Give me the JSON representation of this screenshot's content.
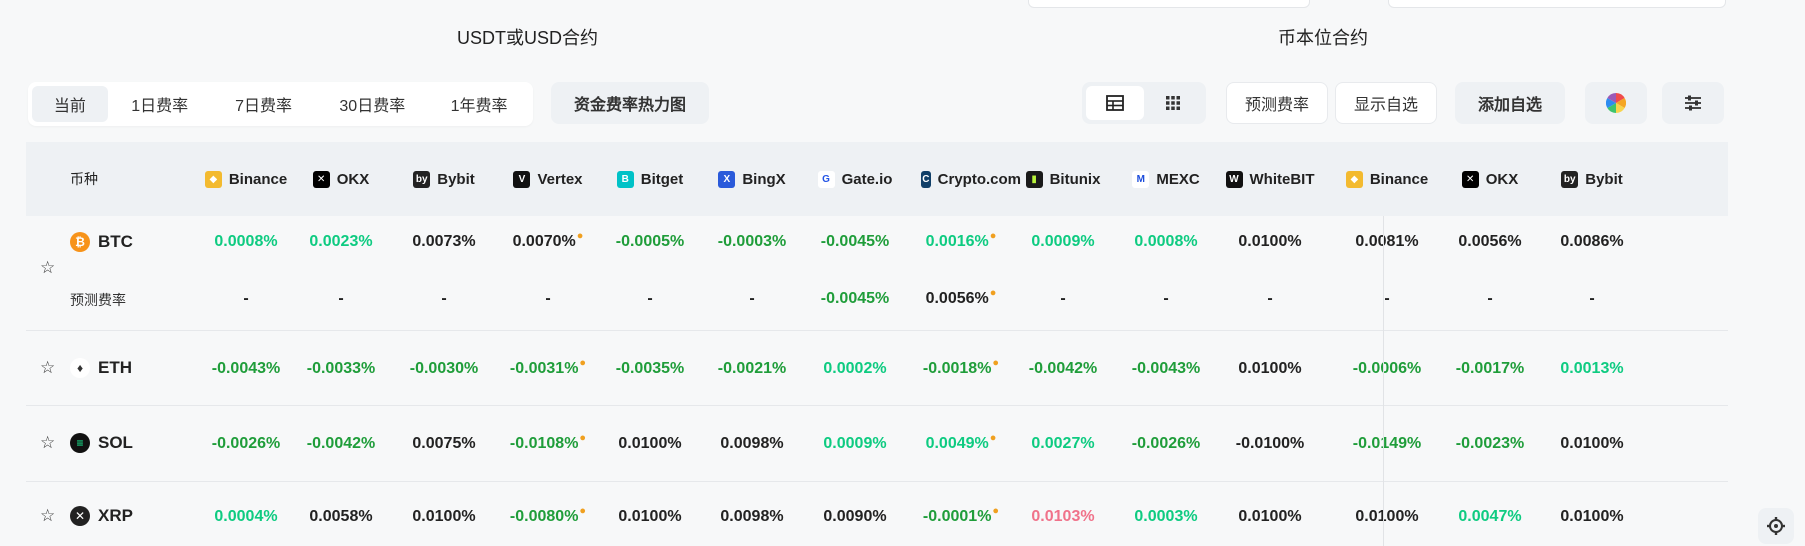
{
  "sections": {
    "left_title": "USDT或USD合约",
    "right_title": "币本位合约"
  },
  "tabs": [
    "当前",
    "1日费率",
    "7日费率",
    "30日费率",
    "1年费率"
  ],
  "toolbar": {
    "heatmap": "资金费率热力图",
    "predict": "预测费率",
    "show_fav": "显示自选",
    "add_fav": "添加自选"
  },
  "table": {
    "coin_header": "币种",
    "exchanges": [
      "Binance",
      "OKX",
      "Bybit",
      "Vertex",
      "Bitget",
      "BingX",
      "Gate.io",
      "Crypto.com",
      "Bitunix",
      "MEXC",
      "WhiteBIT",
      "Binance",
      "OKX",
      "Bybit"
    ],
    "predict_label": "预测费率",
    "rows": [
      {
        "coin": "BTC",
        "values": [
          "0.0008%",
          "0.0023%",
          "0.0073%",
          "0.0070%",
          "-0.0005%",
          "-0.0003%",
          "-0.0045%",
          "0.0016%",
          "0.0009%",
          "0.0008%",
          "0.0100%",
          "0.0081%",
          "0.0056%",
          "0.0086%"
        ],
        "predicted": [
          "-",
          "-",
          "-",
          "-",
          "-",
          "-",
          "-0.0045%",
          "0.0056%",
          "-",
          "-",
          "-",
          "-",
          "-",
          "-"
        ]
      },
      {
        "coin": "ETH",
        "values": [
          "-0.0043%",
          "-0.0033%",
          "-0.0030%",
          "-0.0031%",
          "-0.0035%",
          "-0.0021%",
          "0.0002%",
          "-0.0018%",
          "-0.0042%",
          "-0.0043%",
          "0.0100%",
          "-0.0006%",
          "-0.0017%",
          "0.0013%"
        ]
      },
      {
        "coin": "SOL",
        "values": [
          "-0.0026%",
          "-0.0042%",
          "0.0075%",
          "-0.0108%",
          "0.0100%",
          "0.0098%",
          "0.0009%",
          "0.0049%",
          "0.0027%",
          "-0.0026%",
          "-0.0100%",
          "-0.0149%",
          "-0.0023%",
          "0.0100%"
        ]
      },
      {
        "coin": "XRP",
        "values": [
          "0.0004%",
          "0.0058%",
          "0.0100%",
          "-0.0080%",
          "0.0100%",
          "0.0098%",
          "0.0090%",
          "-0.0001%",
          "0.0103%",
          "0.0003%",
          "0.0100%",
          "0.0100%",
          "0.0047%",
          "0.0100%"
        ]
      }
    ]
  }
}
